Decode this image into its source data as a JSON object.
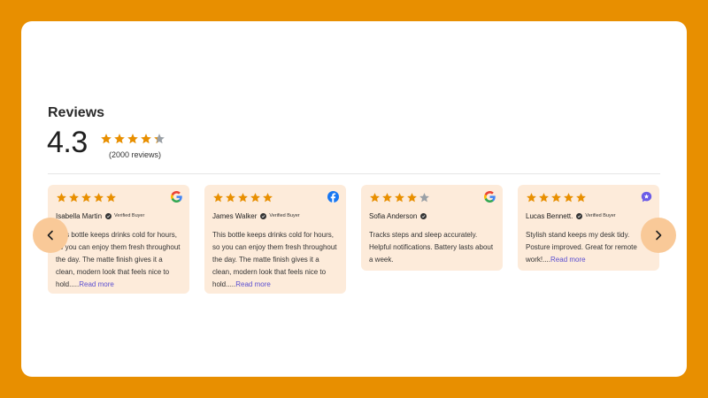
{
  "header": {
    "title": "Reviews",
    "average_rating": "4.3",
    "review_count": "(2000 reviews)",
    "summary_stars": 4.3
  },
  "colors": {
    "page_background": "#E88F00",
    "star_filled": "#E88F00",
    "star_empty": "#9aa0a6",
    "card_background": "#FDEBDA",
    "nav_button": "#F9C998",
    "read_more": "#5b4fd1"
  },
  "reviews": [
    {
      "stars": 5,
      "name": "Isabella Martin",
      "verified": "Verified Buyer",
      "text": "This bottle keeps drinks cold for hours, so you can enjoy them fresh throughout the day. The matte finish gives it a clean, modern look that feels nice to hold.....",
      "read_more": "Read more",
      "source_icon": "google-icon"
    },
    {
      "stars": 5,
      "name": "James Walker",
      "verified": "Verified Buyer",
      "text": "This bottle keeps drinks cold for hours, so you can enjoy them fresh throughout the day. The matte finish gives it a clean, modern look that feels nice to hold.....",
      "read_more": "Read more",
      "source_icon": "facebook-icon"
    },
    {
      "stars": 4,
      "name": "Sofia Anderson",
      "verified": "",
      "text": "Tracks steps and sleep accurately. Helpful notifications. Battery lasts about a week.",
      "read_more": "",
      "source_icon": "google-icon"
    },
    {
      "stars": 5,
      "name": "Lucas Bennett.",
      "verified": "Verified Buyer",
      "text": "Stylish stand keeps my desk tidy. Posture improved. Great for remote work!....",
      "read_more": "Read more",
      "source_icon": "chat-bubble-icon"
    }
  ],
  "nav": {
    "prev_icon": "chevron-left-icon",
    "next_icon": "chevron-right-icon"
  }
}
